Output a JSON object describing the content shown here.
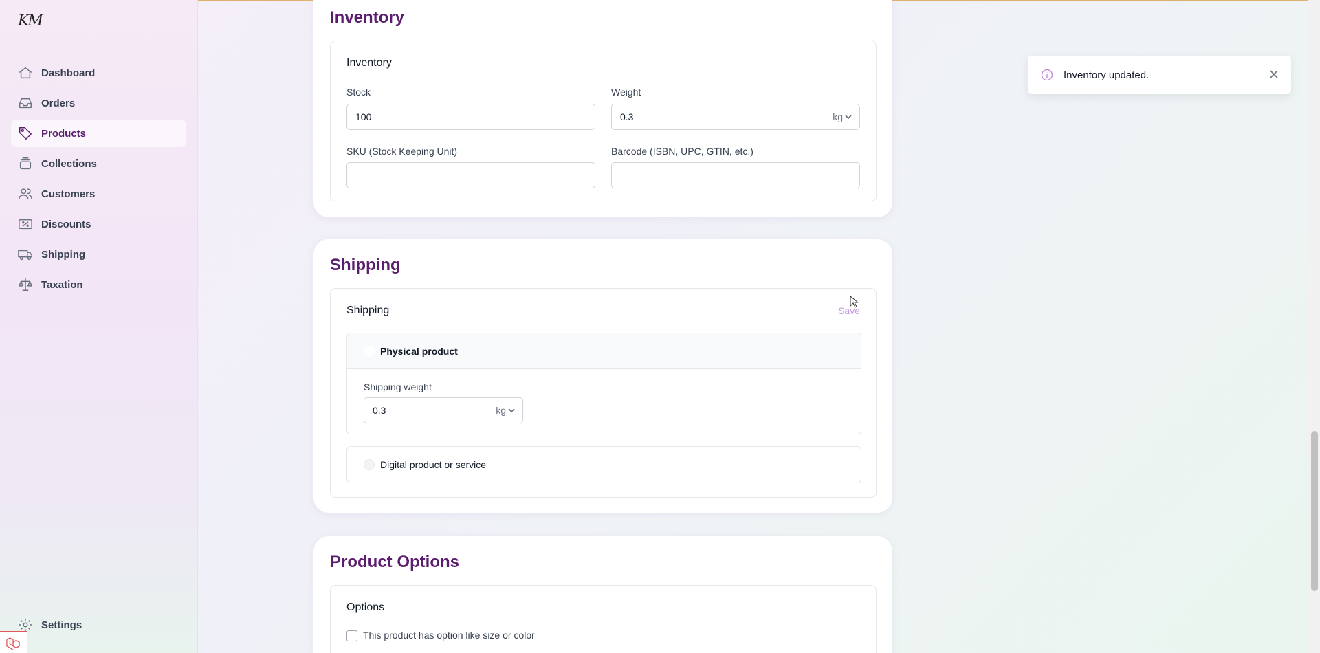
{
  "app": {
    "logo_text": "KM"
  },
  "sidebar": {
    "items": [
      {
        "label": "Dashboard",
        "icon": "home-icon"
      },
      {
        "label": "Orders",
        "icon": "inbox-icon"
      },
      {
        "label": "Products",
        "icon": "tag-icon",
        "active": true
      },
      {
        "label": "Collections",
        "icon": "stack-icon"
      },
      {
        "label": "Customers",
        "icon": "users-icon"
      },
      {
        "label": "Discounts",
        "icon": "ticket-icon"
      },
      {
        "label": "Shipping",
        "icon": "truck-icon"
      },
      {
        "label": "Taxation",
        "icon": "scale-icon"
      }
    ],
    "settings_label": "Settings"
  },
  "inventory": {
    "section_title": "Inventory",
    "card_title": "Inventory",
    "stock_label": "Stock",
    "stock_value": "100",
    "weight_label": "Weight",
    "weight_value": "0.3",
    "weight_unit": "kg",
    "sku_label": "SKU (Stock Keeping Unit)",
    "sku_value": "",
    "barcode_label": "Barcode (ISBN, UPC, GTIN, etc.)",
    "barcode_value": ""
  },
  "shipping": {
    "section_title": "Shipping",
    "card_title": "Shipping",
    "save_label": "Save",
    "physical_label": "Physical product",
    "shipping_weight_label": "Shipping weight",
    "shipping_weight_value": "0.3",
    "shipping_weight_unit": "kg",
    "digital_label": "Digital product or service"
  },
  "options": {
    "section_title": "Product Options",
    "card_title": "Options",
    "has_options_label": "This product has option like size or color"
  },
  "toast": {
    "message": "Inventory updated."
  },
  "colors": {
    "accent": "#5b1d6e",
    "save_link": "#c49be0",
    "info": "#c084d8"
  }
}
